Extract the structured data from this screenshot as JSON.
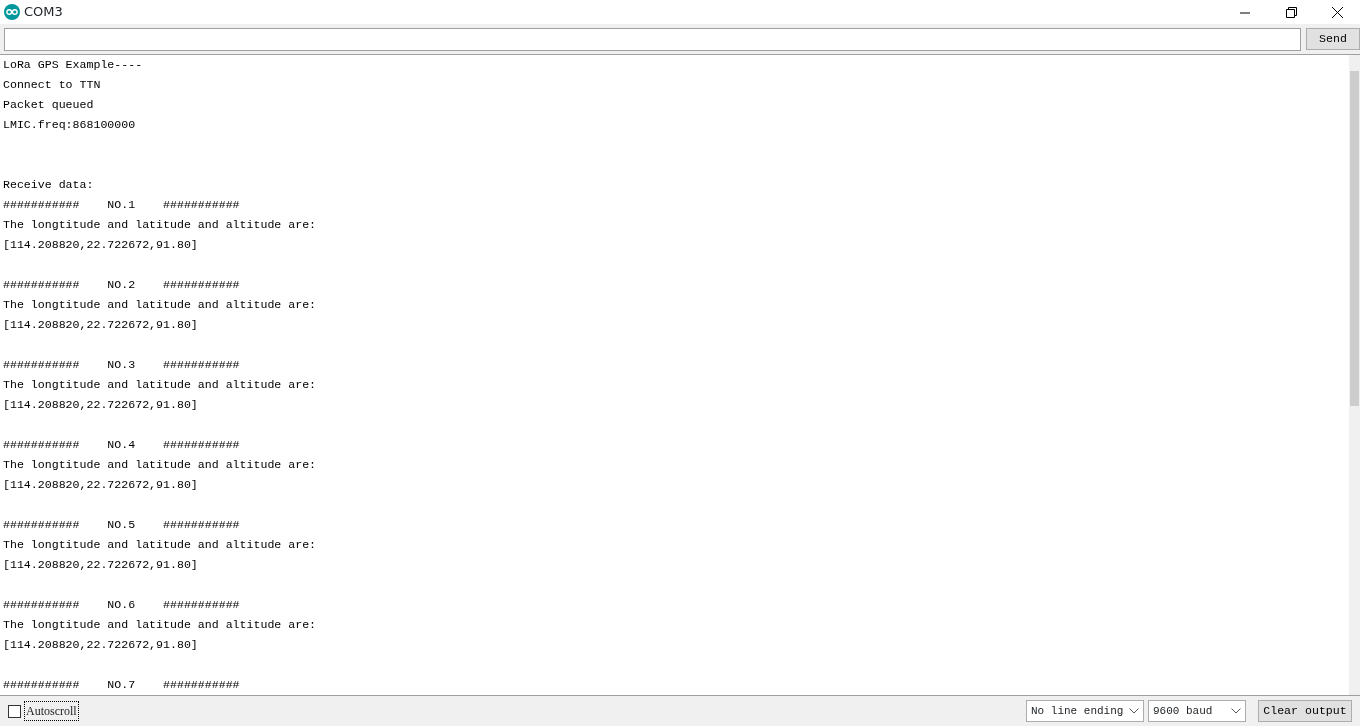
{
  "window": {
    "title": "COM3"
  },
  "send_bar": {
    "send_button": "Send"
  },
  "output": [
    {
      "kind": "text",
      "text": "LoRa GPS Example----"
    },
    {
      "kind": "text",
      "text": "Connect to TTN"
    },
    {
      "kind": "text",
      "text": "Packet queued"
    },
    {
      "kind": "text",
      "text": "LMIC.freq:868100000"
    },
    {
      "kind": "blank"
    },
    {
      "kind": "blank"
    },
    {
      "kind": "text",
      "text": "Receive data:"
    },
    {
      "kind": "text",
      "text": "###########    NO.1    ###########"
    },
    {
      "kind": "text",
      "text": "The longtitude and latitude and altitude are:"
    },
    {
      "kind": "text",
      "text": "[114.208820,22.722672,91.80]"
    },
    {
      "kind": "blank"
    },
    {
      "kind": "text",
      "text": "###########    NO.2    ###########"
    },
    {
      "kind": "text",
      "text": "The longtitude and latitude and altitude are:"
    },
    {
      "kind": "text",
      "text": "[114.208820,22.722672,91.80]"
    },
    {
      "kind": "blank"
    },
    {
      "kind": "text",
      "text": "###########    NO.3    ###########"
    },
    {
      "kind": "text",
      "text": "The longtitude and latitude and altitude are:"
    },
    {
      "kind": "text",
      "text": "[114.208820,22.722672,91.80]"
    },
    {
      "kind": "blank"
    },
    {
      "kind": "text",
      "text": "###########    NO.4    ###########"
    },
    {
      "kind": "text",
      "text": "The longtitude and latitude and altitude are:"
    },
    {
      "kind": "text",
      "text": "[114.208820,22.722672,91.80]"
    },
    {
      "kind": "blank"
    },
    {
      "kind": "text",
      "text": "###########    NO.5    ###########"
    },
    {
      "kind": "text",
      "text": "The longtitude and latitude and altitude are:"
    },
    {
      "kind": "text",
      "text": "[114.208820,22.722672,91.80]"
    },
    {
      "kind": "blank"
    },
    {
      "kind": "text",
      "text": "###########    NO.6    ###########"
    },
    {
      "kind": "text",
      "text": "The longtitude and latitude and altitude are:"
    },
    {
      "kind": "text",
      "text": "[114.208820,22.722672,91.80]"
    },
    {
      "kind": "blank"
    },
    {
      "kind": "text",
      "text": "###########    NO.7    ###########"
    }
  ],
  "footer": {
    "autoscroll": {
      "label": "Autoscroll",
      "checked": false
    },
    "line_ending": "No line ending",
    "baud": "9600 baud",
    "clear_button": "Clear output"
  }
}
